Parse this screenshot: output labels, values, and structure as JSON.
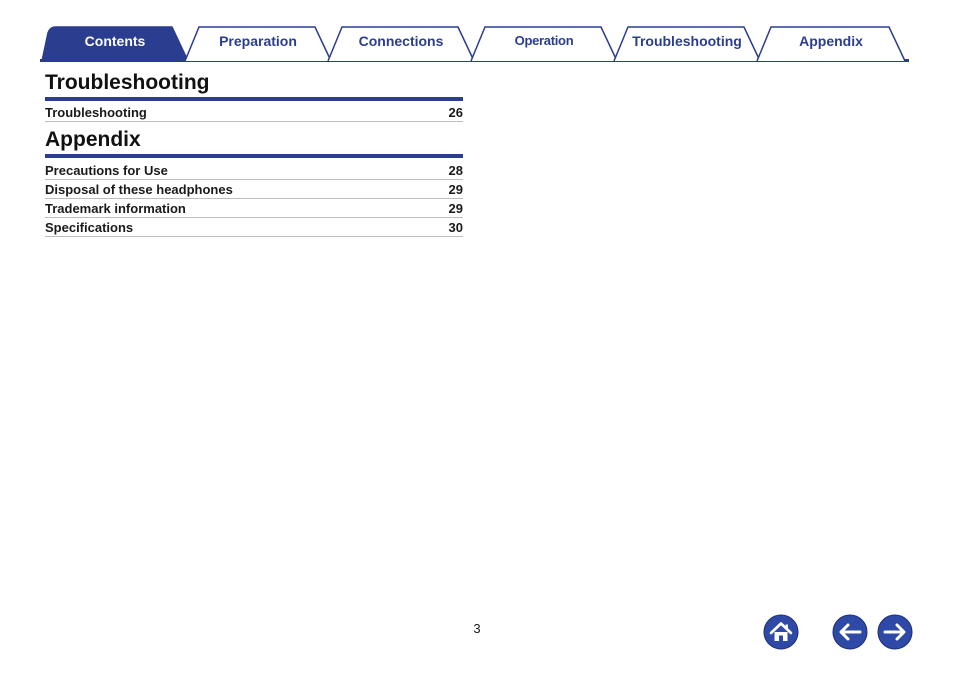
{
  "tabs": [
    {
      "label": "Contents",
      "active": true
    },
    {
      "label": "Preparation",
      "active": false
    },
    {
      "label": "Connections",
      "active": false
    },
    {
      "label": "Operation",
      "active": false
    },
    {
      "label": "Troubleshooting",
      "active": false
    },
    {
      "label": "Appendix",
      "active": false
    }
  ],
  "sections": [
    {
      "title": "Troubleshooting",
      "items": [
        {
          "label": "Troubleshooting",
          "page": "26"
        }
      ]
    },
    {
      "title": "Appendix",
      "items": [
        {
          "label": "Precautions for Use",
          "page": "28"
        },
        {
          "label": "Disposal of these headphones",
          "page": "29"
        },
        {
          "label": "Trademark information",
          "page": "29"
        },
        {
          "label": "Specifications",
          "page": "30"
        }
      ]
    }
  ],
  "footer": {
    "page_number": "3",
    "home_icon": "home-icon",
    "back_icon": "arrow-left-icon",
    "forward_icon": "arrow-right-icon"
  },
  "colors": {
    "accent": "#2b3d8f",
    "button_fill": "#2f4aa6"
  }
}
